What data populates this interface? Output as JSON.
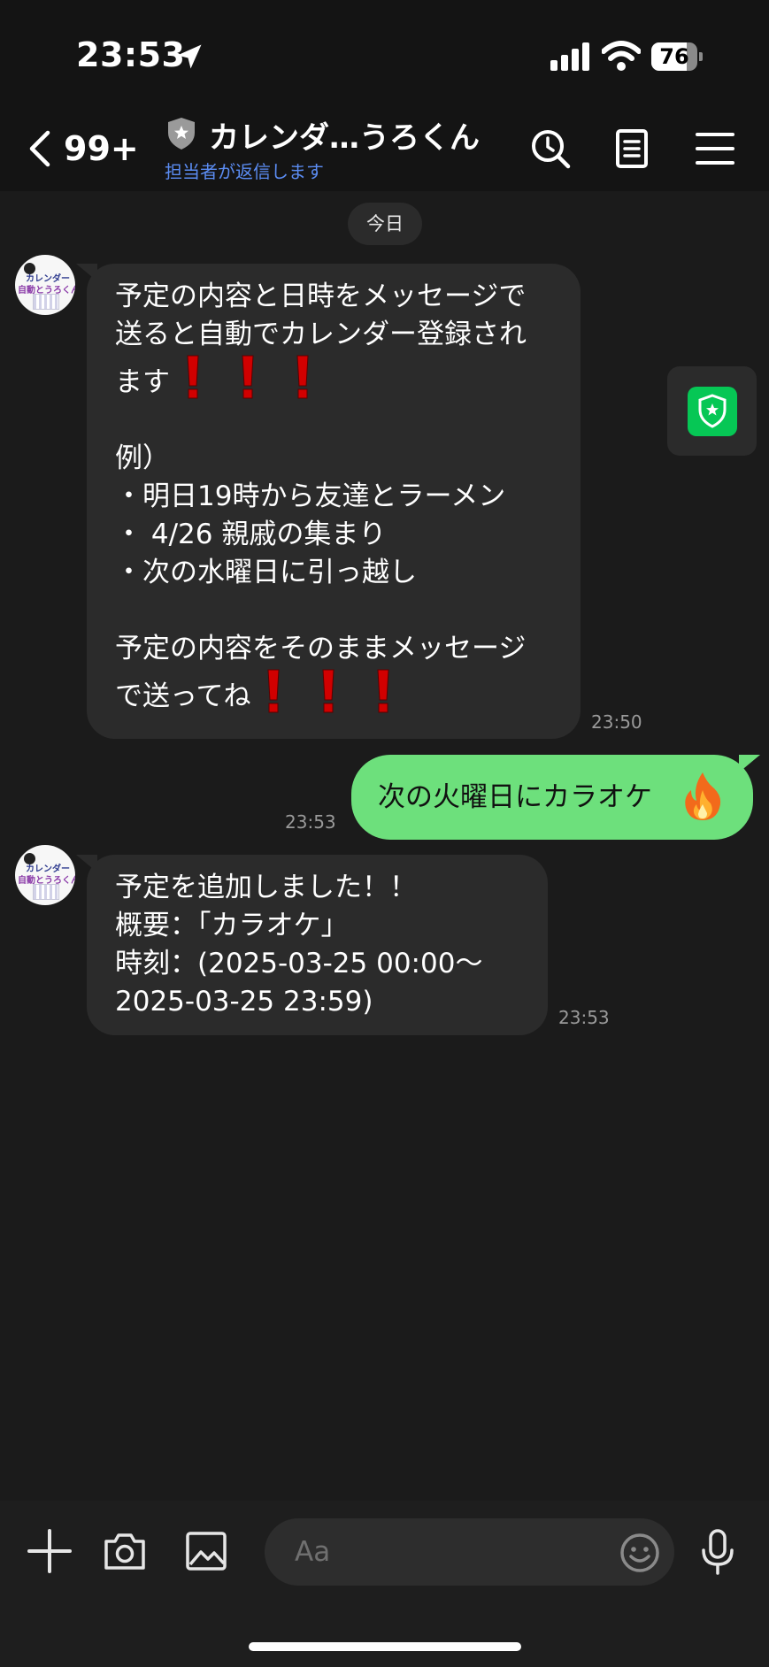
{
  "status_bar": {
    "time": "23:53",
    "battery": "76",
    "battery_level": 0.76
  },
  "header": {
    "back_count": "99+",
    "title": "カレンダ…うろくん",
    "subtitle": "担当者が返信します"
  },
  "date_divider": "今日",
  "avatar_text": {
    "line1": "カレンダー",
    "line2": "自動とうろくん"
  },
  "messages": [
    {
      "sender": "bot",
      "lines": [
        "予定の内容と日時をメッセージで",
        "送ると自動でカレンダー登録され",
        "ます",
        "",
        "例）",
        "・明日19時から友達とラーメン",
        "・ 4/26 親戚の集まり",
        "・次の水曜日に引っ越し",
        "",
        "予定の内容をそのままメッセージ",
        "で送ってね"
      ],
      "time": "23:50"
    },
    {
      "sender": "me",
      "text": "次の火曜日にカラオケ",
      "emoji": "fire-emoji",
      "time": "23:53"
    },
    {
      "sender": "bot",
      "lines": [
        "予定を追加しました！！",
        " 概要：「カラオケ」",
        "時刻：(2025-03-25 00:00～",
        " 2025-03-25 23:59)"
      ],
      "time": "23:53"
    }
  ],
  "input": {
    "placeholder": "Aa"
  },
  "colors": {
    "background": "#1b1b1b",
    "bubble_in": "#2b2b2b",
    "bubble_out": "#6de07c",
    "accent_link": "#5b8cf2",
    "line_green": "#06c755",
    "exclamation_red": "#d10000"
  }
}
